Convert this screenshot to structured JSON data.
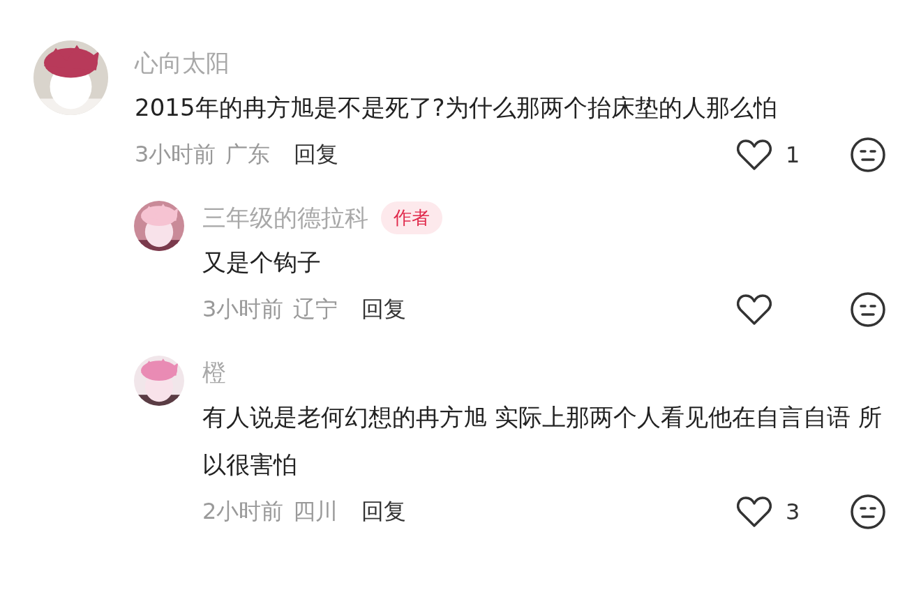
{
  "comments": [
    {
      "user": "心向太阳",
      "text": "2015年的冉方旭是不是死了?为什么那两个抬床垫的人那么怕",
      "time": "3小时前",
      "location": "广东",
      "reply": "回复",
      "likes": "1",
      "replies": [
        {
          "user": "三年级的德拉科",
          "badge": "作者",
          "text": "又是个钩子",
          "time": "3小时前",
          "location": "辽宁",
          "reply": "回复"
        },
        {
          "user": "橙",
          "text": "有人说是老何幻想的冉方旭  实际上那两个人看见他在自言自语 所以很害怕",
          "time": "2小时前",
          "location": "四川",
          "reply": "回复",
          "likes": "3"
        }
      ]
    }
  ]
}
